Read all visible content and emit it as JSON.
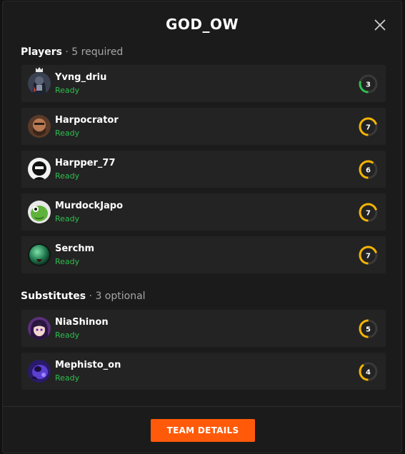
{
  "modal": {
    "title": "GOD_OW",
    "close_icon": "close-icon"
  },
  "players_section": {
    "label": "Players",
    "separator": "·",
    "note": "5 required"
  },
  "players": [
    {
      "name": "Yvng_driu",
      "status": "Ready",
      "level": "3",
      "gauge_fraction": 0.3,
      "gauge_color": "#2fbe4f",
      "captain": true,
      "avatar": "avatar-dark-armor"
    },
    {
      "name": "Harpocrator",
      "status": "Ready",
      "level": "7",
      "gauge_fraction": 0.7,
      "gauge_color": "#f5b400",
      "captain": false,
      "avatar": "avatar-bearded-man"
    },
    {
      "name": "Harpper_77",
      "status": "Ready",
      "level": "6",
      "gauge_fraction": 0.6,
      "gauge_color": "#f5b400",
      "captain": false,
      "avatar": "avatar-masked-face"
    },
    {
      "name": "MurdockJapo",
      "status": "Ready",
      "level": "7",
      "gauge_fraction": 0.7,
      "gauge_color": "#f5b400",
      "captain": false,
      "avatar": "avatar-green-frog"
    },
    {
      "name": "Serchm",
      "status": "Ready",
      "level": "7",
      "gauge_fraction": 0.7,
      "gauge_color": "#f5b400",
      "captain": false,
      "avatar": "avatar-green-orb"
    }
  ],
  "substitutes_section": {
    "label": "Substitutes",
    "separator": "·",
    "note": "3 optional"
  },
  "substitutes": [
    {
      "name": "NiaShinon",
      "status": "Ready",
      "level": "5",
      "gauge_fraction": 0.5,
      "gauge_color": "#f5b400",
      "avatar": "avatar-anime-girl"
    },
    {
      "name": "Mephisto_on",
      "status": "Ready",
      "level": "4",
      "gauge_fraction": 0.4,
      "gauge_color": "#f5b400",
      "avatar": "avatar-purple-creature"
    }
  ],
  "footer": {
    "button_label": "TEAM DETAILS",
    "button_color": "#ff5a0a"
  },
  "colors": {
    "ready": "#2fbe4f",
    "background": "#1b1b1b",
    "row": "#232323"
  }
}
